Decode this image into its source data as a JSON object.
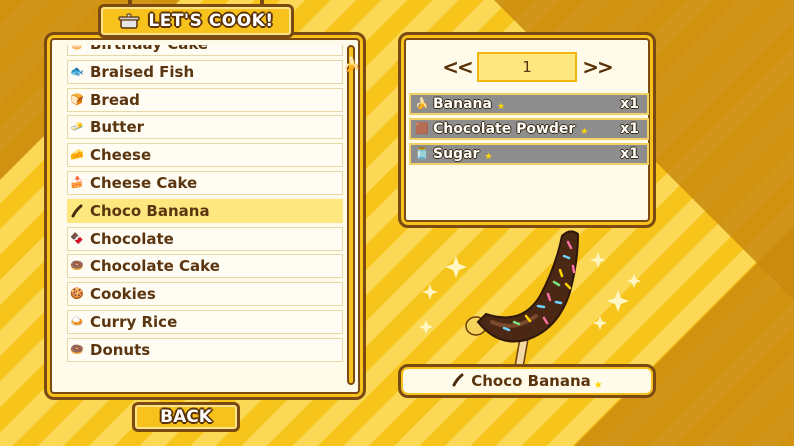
{
  "title": "LET'S COOK!",
  "recipes": [
    {
      "label": "Birthday Cake",
      "icon": "birthday-cake-icon"
    },
    {
      "label": "Braised Fish",
      "icon": "braised-fish-icon"
    },
    {
      "label": "Bread",
      "icon": "bread-icon"
    },
    {
      "label": "Butter",
      "icon": "butter-icon"
    },
    {
      "label": "Cheese",
      "icon": "cheese-icon"
    },
    {
      "label": "Cheese Cake",
      "icon": "cheese-cake-icon"
    },
    {
      "label": "Choco Banana",
      "icon": "choco-banana-icon",
      "selected": true
    },
    {
      "label": "Chocolate",
      "icon": "chocolate-icon"
    },
    {
      "label": "Chocolate Cake",
      "icon": "chocolate-cake-icon"
    },
    {
      "label": "Cookies",
      "icon": "cookies-icon"
    },
    {
      "label": "Curry Rice",
      "icon": "curry-rice-icon"
    },
    {
      "label": "Donuts",
      "icon": "donuts-icon"
    }
  ],
  "back_label": "BACK",
  "quantity": {
    "value": "1",
    "decrease_label": "<<",
    "increase_label": ">>"
  },
  "ingredients": [
    {
      "name": "Banana",
      "qty": "x1",
      "icon": "banana-icon"
    },
    {
      "name": "Chocolate Powder",
      "qty": "x1",
      "icon": "chocolate-powder-icon"
    },
    {
      "name": "Sugar",
      "qty": "x1",
      "icon": "sugar-icon"
    }
  ],
  "selected_dish": {
    "label": "Choco Banana",
    "icon": "choco-banana-icon"
  },
  "colors": {
    "panel_border": "#7a4a12",
    "accent_yellow": "#f7c21c",
    "selected_row": "#fde77f",
    "ingredient_row": "#8d8d8d",
    "background_dark": "#c98a0e"
  }
}
